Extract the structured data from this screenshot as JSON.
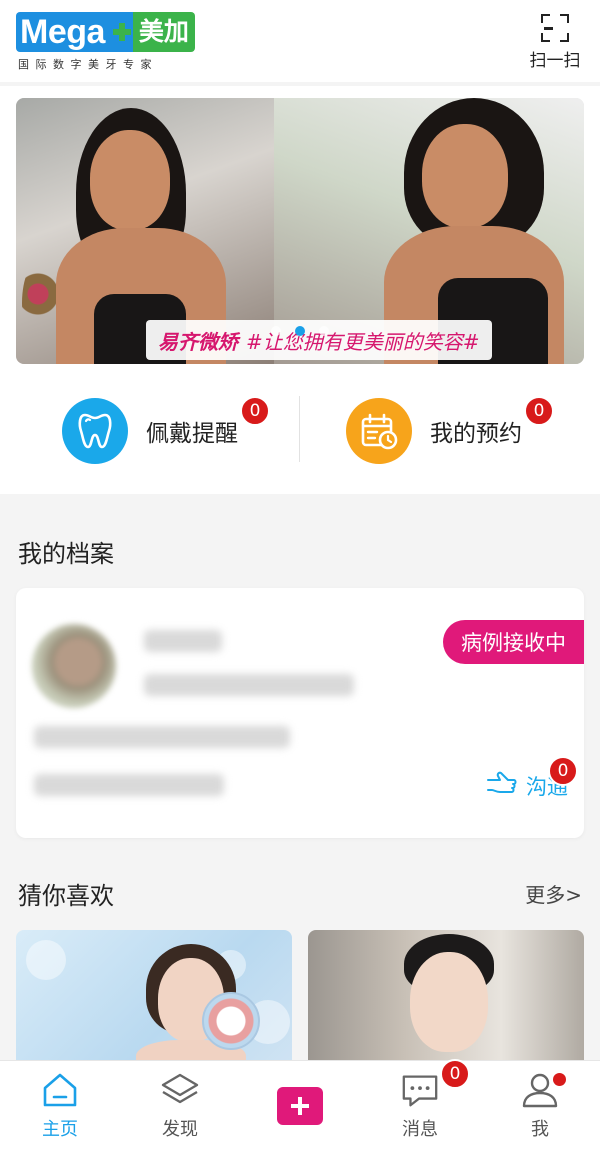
{
  "header": {
    "logo_mega": "Mega",
    "logo_cn": "美加",
    "logo_tagline": "国际数字美牙专家",
    "scan_label": "扫一扫"
  },
  "banner": {
    "brand": "易齐微矫",
    "slogan": "#让您拥有更美丽的笑容#",
    "active_slide": 2,
    "slide_count": 3
  },
  "shortcuts": [
    {
      "label": "佩戴提醒",
      "badge": "0",
      "icon": "tooth-icon",
      "color": "#1aa8ea"
    },
    {
      "label": "我的预约",
      "badge": "0",
      "icon": "calendar-clock-icon",
      "color": "#f7a41b"
    }
  ],
  "archive": {
    "title": "我的档案",
    "status": "病例接收中",
    "communicate_label": "沟通",
    "communicate_badge": "0"
  },
  "recommend": {
    "title": "猜你喜欢",
    "more_label": "更多>"
  },
  "tabbar": {
    "items": [
      {
        "label": "主页",
        "icon": "home-icon",
        "active": true
      },
      {
        "label": "发现",
        "icon": "layers-icon",
        "active": false
      },
      {
        "label": "",
        "icon": "plus-icon",
        "active": false
      },
      {
        "label": "消息",
        "icon": "message-icon",
        "active": false,
        "badge": "0"
      },
      {
        "label": "我",
        "icon": "user-icon",
        "active": false,
        "dot": true
      }
    ]
  },
  "colors": {
    "accent_blue": "#1aa0e8",
    "accent_pink": "#e0197a",
    "badge_red": "#d81a1a",
    "orange": "#f7a41b",
    "logo_blue": "#1d8fe0",
    "logo_green": "#3bb34a"
  }
}
